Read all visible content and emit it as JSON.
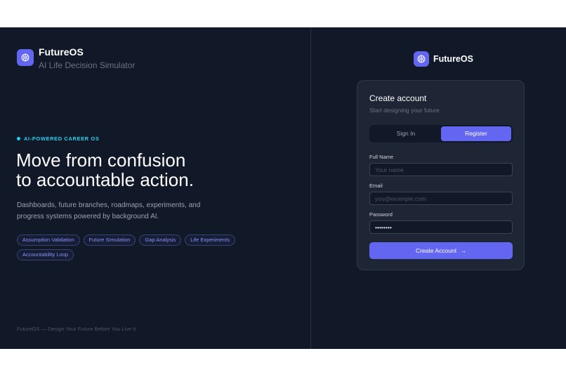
{
  "brand": {
    "name": "FutureOS",
    "tagline": "AI Life Decision Simulator",
    "accent": "#6366f1"
  },
  "hero": {
    "eyebrow": "AI-POWERED CAREER OS",
    "headline_line1": "Move from confusion",
    "headline_line2": "to accountable action.",
    "description": "Dashboards, future branches, roadmaps, experiments, and progress systems powered by background AI.",
    "chips": [
      "Assumption Validation",
      "Future Simulation",
      "Gap Analysis",
      "Life Experiments",
      "Accountability Loop"
    ]
  },
  "footer": {
    "text": "FutureOS — Design Your Future Before You Live It"
  },
  "auth": {
    "brand_name": "FutureOS",
    "title": "Create account",
    "subtitle": "Start designing your future",
    "tabs": [
      {
        "label": "Sign In",
        "active": false
      },
      {
        "label": "Register",
        "active": true
      }
    ],
    "fields": {
      "full_name": {
        "label": "Full Name",
        "placeholder": "Your name",
        "value": ""
      },
      "email": {
        "label": "Email",
        "placeholder": "you@example.com",
        "value": ""
      },
      "password": {
        "label": "Password",
        "placeholder": "",
        "value": "••••••••"
      }
    },
    "submit_label": "Create Account",
    "submit_arrow": "→"
  },
  "icons": {
    "logo": "brain-icon"
  }
}
